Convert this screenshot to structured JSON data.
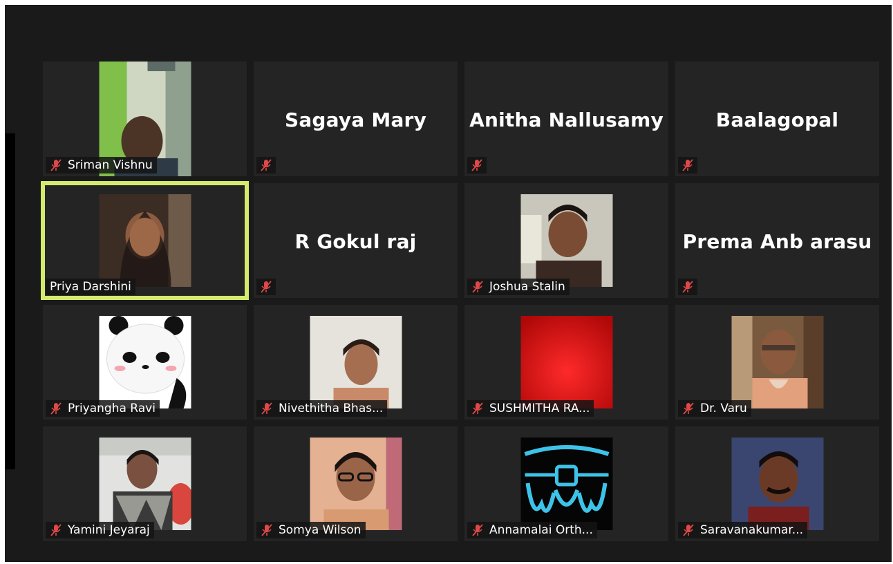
{
  "participants": [
    {
      "name": "Sriman Vishnu",
      "muted": true,
      "video": "room-green",
      "active": false
    },
    {
      "name": "Sagaya Mary",
      "muted": true,
      "video": null,
      "active": false
    },
    {
      "name": "Anitha Nallusamy",
      "muted": true,
      "video": null,
      "active": false
    },
    {
      "name": "Baalagopal",
      "muted": true,
      "video": null,
      "active": false
    },
    {
      "name": "Priya Darshini",
      "muted": false,
      "video": "room-dark",
      "active": true
    },
    {
      "name": "R Gokul raj",
      "muted": true,
      "video": null,
      "active": false
    },
    {
      "name": "Joshua Stalin",
      "muted": true,
      "video": "room-light",
      "active": false
    },
    {
      "name": "Prema Anb arasu",
      "muted": true,
      "video": null,
      "active": false
    },
    {
      "name": "Priyangha Ravi",
      "muted": true,
      "video": "panda",
      "active": false
    },
    {
      "name": "Nivethitha Bhas...",
      "muted": true,
      "video": "room-plain",
      "active": false
    },
    {
      "name": "SUSHMITHA RA...",
      "muted": true,
      "video": "red",
      "active": false
    },
    {
      "name": "Dr. Varu",
      "muted": true,
      "video": "room-warm",
      "active": false
    },
    {
      "name": "Yamini Jeyaraj",
      "muted": true,
      "video": "room-office",
      "active": false
    },
    {
      "name": "Somya Wilson",
      "muted": true,
      "video": "room-peach",
      "active": false
    },
    {
      "name": "Annamalai Orth...",
      "muted": true,
      "video": "braces-logo",
      "active": false
    },
    {
      "name": "Saravanakumar...",
      "muted": true,
      "video": "room-portrait",
      "active": false
    }
  ],
  "colors": {
    "background": "#1a1a1a",
    "tile": "#242424",
    "active_border": "#d4ea6c",
    "mute_red": "#e04848"
  },
  "icons": {
    "mute": "microphone-muted-icon"
  }
}
